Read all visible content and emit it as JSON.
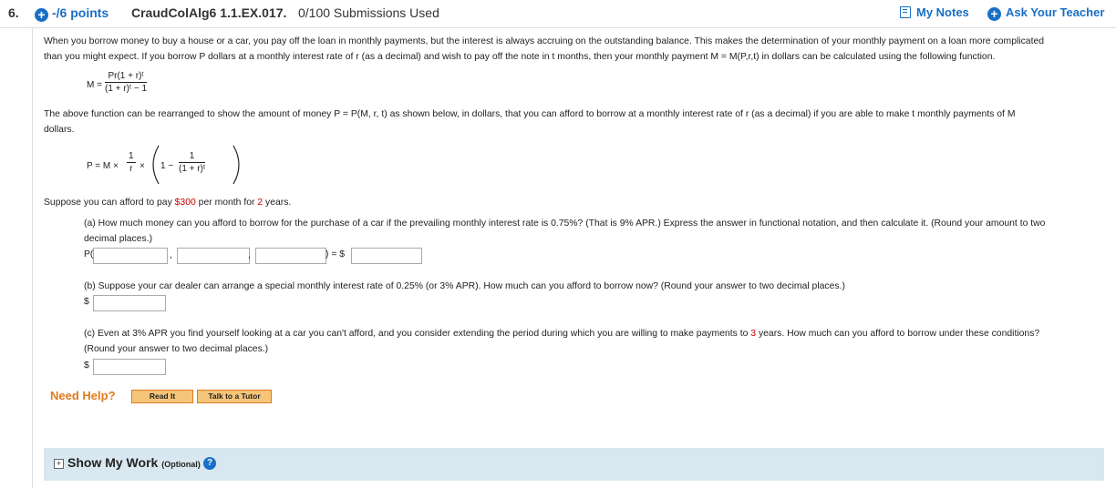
{
  "header": {
    "question_number": "6.",
    "points": "-/6 points",
    "code": "CraudColAlg6 1.1.EX.017.",
    "submissions": "0/100 Submissions Used",
    "my_notes": "My Notes",
    "ask_teacher": "Ask Your Teacher"
  },
  "intro": {
    "line1": "When you borrow money to buy a house or a car, you pay off the loan in monthly payments, but the interest is always accruing on the outstanding balance. This makes the determination of your monthly payment on a loan more complicated",
    "line2": "than you might expect. If you borrow P dollars at a monthly interest rate of r (as a decimal) and wish to pay off the note in t months, then your monthly payment M = M(P,r,t) in dollars can be calculated using the following function."
  },
  "formula1": {
    "lhs": "M =",
    "numerator": "Pr(1 + r)ᵗ",
    "denominator": "(1 + r)ᵗ − 1"
  },
  "rearranged": {
    "line1": "The above function can be rearranged to show the amount of money P = P(M, r, t) as shown below, in dollars, that you can afford to borrow at a monthly interest rate of r (as a decimal) if you are able to make t monthly payments of M",
    "line2": "dollars."
  },
  "formula2": {
    "lhs": "P = M ×",
    "frac_num": "1",
    "frac_den": "r",
    "times": "×",
    "one_minus": "1 −",
    "inner_num": "1",
    "inner_den": "(1 + r)ᵗ"
  },
  "suppose": {
    "prefix": "Suppose you can afford to pay ",
    "amount": "$300",
    "middle": " per month for ",
    "years": "2",
    "suffix": " years."
  },
  "part_a": {
    "line1": "(a) How much money can you afford to borrow for the purchase of a car if the prevailing monthly interest rate is 0.75%? (That is 9% APR.) Express the answer in functional notation, and then calculate it. (Round your amount to two",
    "line2": "decimal places.)",
    "p_open": "P(",
    "comma1": ",",
    "comma2": ",",
    "close_eq": ") = $",
    "input1": "",
    "input2": "",
    "input3": "",
    "input4": ""
  },
  "part_b": {
    "text": "(b) Suppose your car dealer can arrange a special monthly interest rate of 0.25% (or 3% APR). How much can you afford to borrow now? (Round your answer to two decimal places.)",
    "dollar": "$",
    "input": ""
  },
  "part_c": {
    "prefix": "(c) Even at 3% APR you find yourself looking at a car you can't afford, and you consider extending the period during which you are willing to make payments to ",
    "years": "3",
    "suffix": " years. How much can you afford to borrow under these conditions?",
    "line2": "(Round your answer to two decimal places.)",
    "dollar": "$",
    "input": ""
  },
  "help": {
    "need_help": "Need Help?",
    "read_it": "Read It",
    "talk_tutor": "Talk to a Tutor"
  },
  "show_work": {
    "toggle": "+",
    "label": "Show My Work",
    "optional": "(Optional)",
    "help_icon": "?"
  },
  "colors": {
    "accent": "#1a6fc4",
    "highlight": "#cc0000",
    "help": "#e07a1c",
    "panel": "#d9e8f0"
  }
}
